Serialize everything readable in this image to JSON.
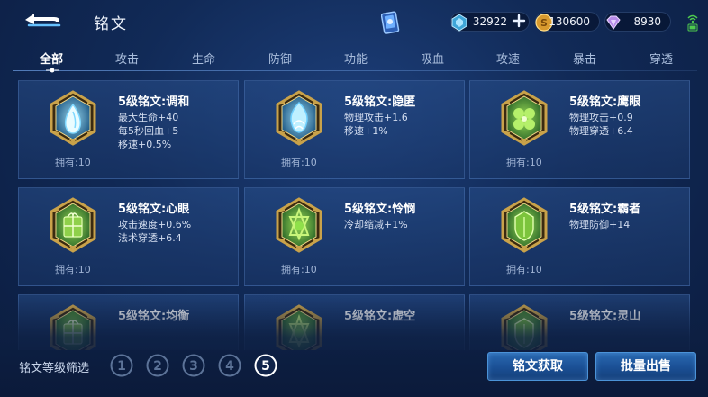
{
  "header": {
    "title": "铭文",
    "currencies": [
      {
        "name": "diamond-icon",
        "value": "32922"
      },
      {
        "name": "gold-coin-icon",
        "value": "130600"
      },
      {
        "name": "gem-icon",
        "value": "8930"
      }
    ]
  },
  "tabs": [
    {
      "label": "全部",
      "active": true
    },
    {
      "label": "攻击"
    },
    {
      "label": "生命"
    },
    {
      "label": "防御"
    },
    {
      "label": "功能"
    },
    {
      "label": "吸血"
    },
    {
      "label": "攻速"
    },
    {
      "label": "暴击"
    },
    {
      "label": "穿透"
    }
  ],
  "inscriptions": [
    {
      "name": "5级铭文:调和",
      "attrs": [
        "最大生命+40",
        "每5秒回血+5",
        "移速+0.5%"
      ],
      "owned": "拥有:10",
      "color": "blue",
      "symbol": "drop"
    },
    {
      "name": "5级铭文:隐匿",
      "attrs": [
        "物理攻击+1.6",
        "移速+1%"
      ],
      "owned": "拥有:10",
      "color": "blue",
      "symbol": "flame"
    },
    {
      "name": "5级铭文:鹰眼",
      "attrs": [
        "物理攻击+0.9",
        "物理穿透+6.4"
      ],
      "owned": "拥有:10",
      "color": "green",
      "symbol": "clover"
    },
    {
      "name": "5级铭文:心眼",
      "attrs": [
        "攻击速度+0.6%",
        "法术穿透+6.4"
      ],
      "owned": "拥有:10",
      "color": "green",
      "symbol": "gift"
    },
    {
      "name": "5级铭文:怜悯",
      "attrs": [
        "冷却缩减+1%"
      ],
      "owned": "拥有:10",
      "color": "green",
      "symbol": "star"
    },
    {
      "name": "5级铭文:霸者",
      "attrs": [
        "物理防御+14"
      ],
      "owned": "拥有:10",
      "color": "green",
      "symbol": "shield"
    },
    {
      "name": "5级铭文:均衡",
      "attrs": [],
      "owned": "",
      "color": "green",
      "symbol": "gift"
    },
    {
      "name": "5级铭文:虚空",
      "attrs": [],
      "owned": "",
      "color": "green",
      "symbol": "star"
    },
    {
      "name": "5级铭文:灵山",
      "attrs": [],
      "owned": "",
      "color": "green",
      "symbol": "shield"
    }
  ],
  "footer": {
    "filter_label": "铭文等级筛选",
    "levels": [
      "1",
      "2",
      "3",
      "4",
      "5"
    ],
    "selected_level": "5",
    "get_button": "铭文获取",
    "sell_button": "批量出售"
  }
}
